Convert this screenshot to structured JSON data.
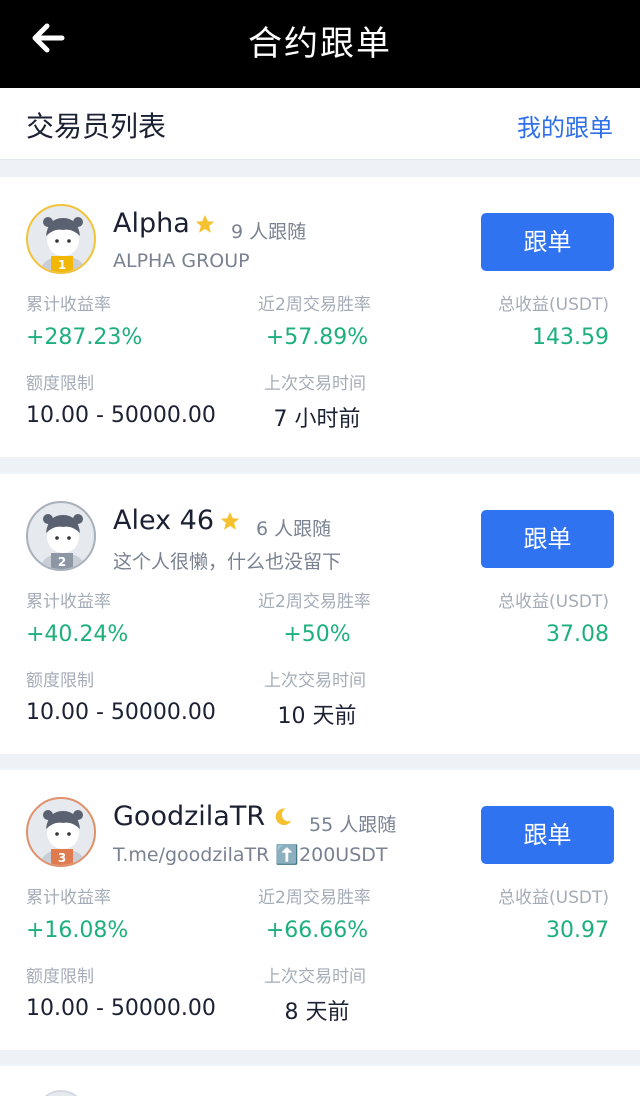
{
  "header": {
    "title": "合约跟单",
    "back_icon": "arrow-left-icon"
  },
  "subheader": {
    "title": "交易员列表",
    "my_follow_link": "我的跟单"
  },
  "labels": {
    "cumulative_return": "累计收益率",
    "win_rate": "近2周交易胜率",
    "total_profit": "总收益(USDT)",
    "limit": "额度限制",
    "last_trade": "上次交易时间",
    "follow_button": "跟单"
  },
  "traders": [
    {
      "rank": "1",
      "name": "Alpha",
      "badge": "star-icon",
      "followers": "9 人跟随",
      "bio": "ALPHA GROUP",
      "cumulative_return": "+287.23%",
      "win_rate": "+57.89%",
      "total_profit": "143.59",
      "limit": "10.00 - 50000.00",
      "last_trade": "7 小时前"
    },
    {
      "rank": "2",
      "name": "Alex 46",
      "badge": "star-icon",
      "followers": "6 人跟随",
      "bio": "这个人很懒，什么也没留下",
      "cumulative_return": "+40.24%",
      "win_rate": "+50%",
      "total_profit": "37.08",
      "limit": "10.00 - 50000.00",
      "last_trade": "10 天前"
    },
    {
      "rank": "3",
      "name": "GoodzilaTR",
      "badge": "moon-icon",
      "followers": "55 人跟随",
      "bio": "T.me/goodzilaTR ⬆️200USDT",
      "cumulative_return": "+16.08%",
      "win_rate": "+66.66%",
      "total_profit": "30.97",
      "limit": "10.00 - 50000.00",
      "last_trade": "8 天前"
    }
  ],
  "colors": {
    "accent": "#2f73f0",
    "positive": "#1db07d",
    "header_bg": "#000000"
  }
}
